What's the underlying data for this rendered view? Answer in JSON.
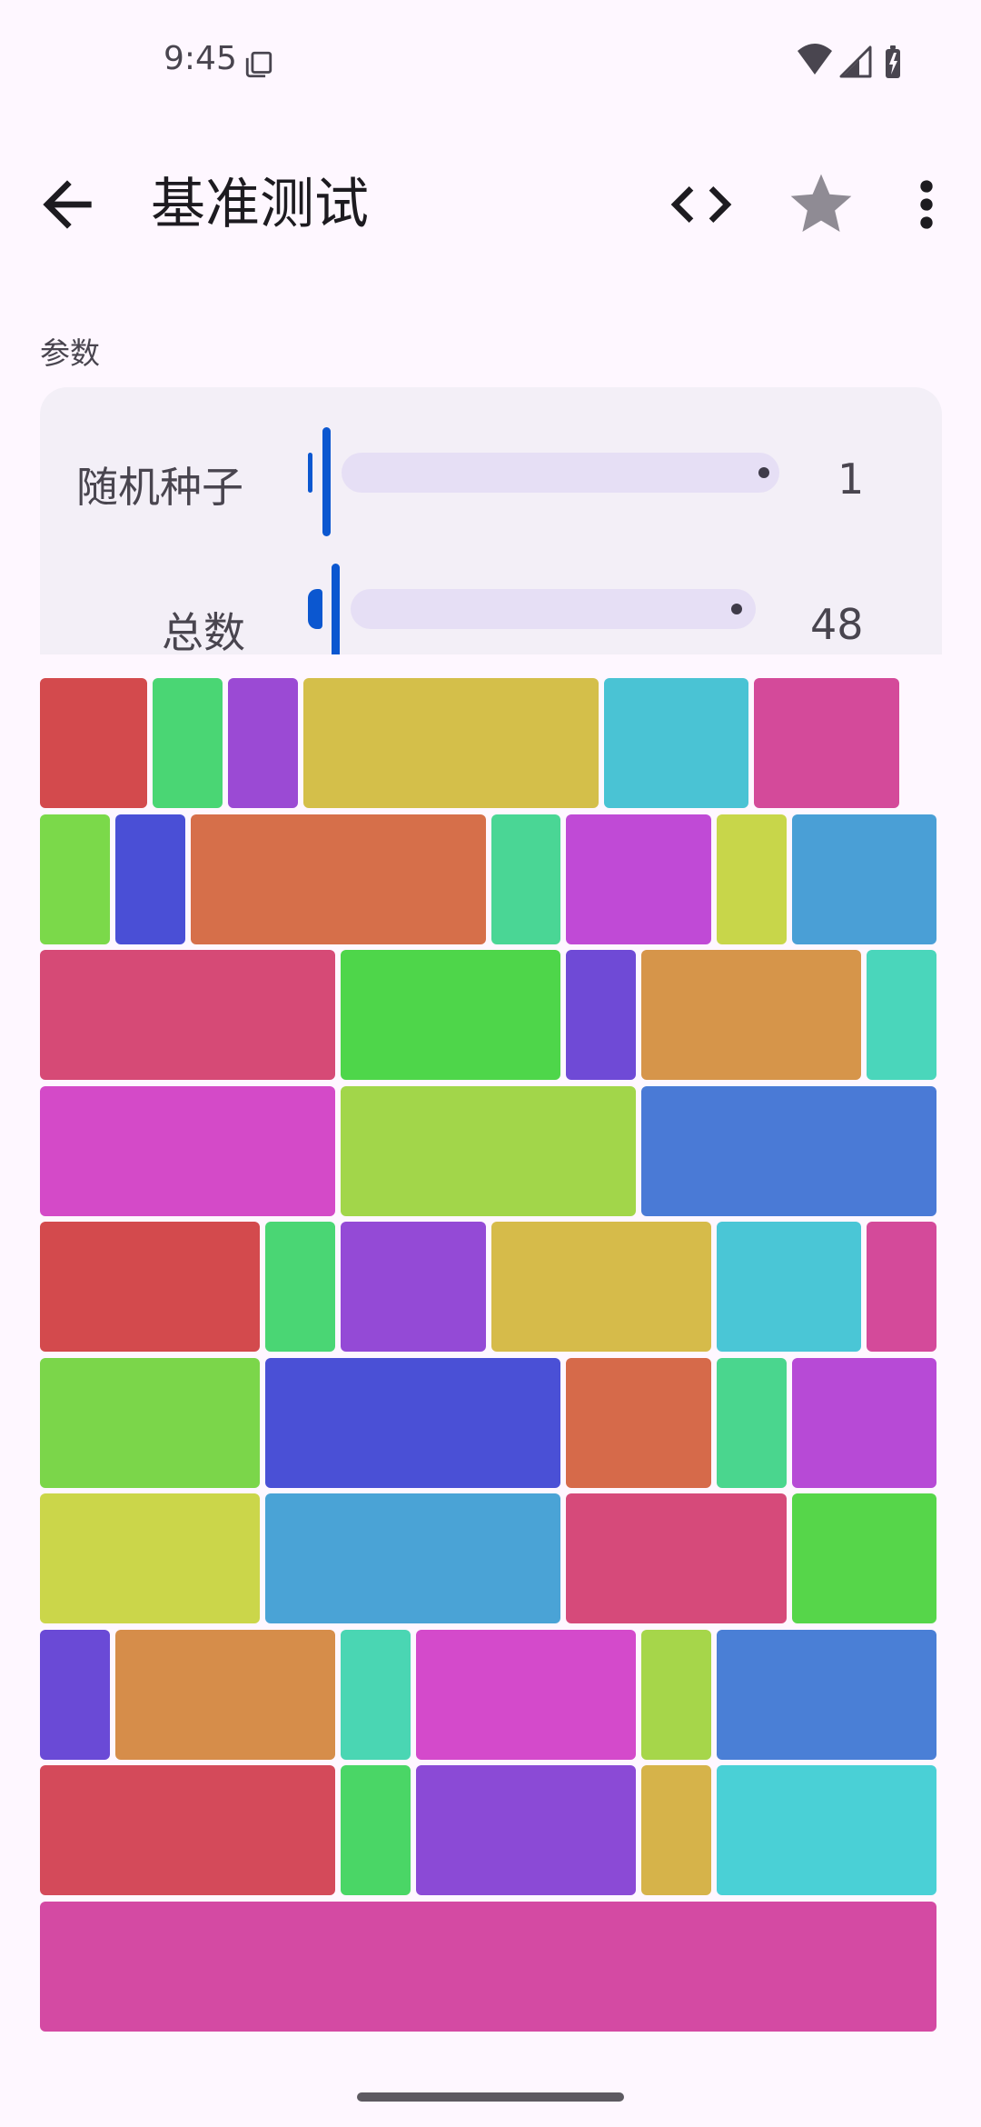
{
  "status_bar": {
    "time": "9:45",
    "icons": [
      "notification-copy-icon",
      "wifi-icon",
      "cellular-icon",
      "battery-charging-icon"
    ]
  },
  "app_bar": {
    "title": "基准测试",
    "back_icon": "arrow-back-icon",
    "actions": [
      "code-icon",
      "star-icon",
      "more-vert-icon"
    ]
  },
  "params": {
    "section_label": "参数",
    "seed": {
      "label": "随机种子",
      "value": "1"
    },
    "total": {
      "label": "总数",
      "value": "48"
    }
  },
  "tiles": {
    "colors": [
      [
        "#d34a4d",
        "#4ad674",
        "#9b4ad4",
        "#d4bf4a",
        "#4ac3d4",
        "#d44a9a"
      ],
      [
        "#7bd94a",
        "#4a4fd6",
        "#d66f4a",
        "#4ad695",
        "#c04ad6",
        "#c8d64a",
        "#4a9fd6"
      ],
      [
        "#d64a76",
        "#4ed64a",
        "#6f4ad6",
        "#d6954a",
        "#4ad6bb"
      ],
      [
        "#d44ac8",
        "#a2d64a",
        "#4a7ad6"
      ],
      [
        "#d34a4d",
        "#4ad674",
        "#944ad6",
        "#d6bb4a",
        "#4ac6d6",
        "#d44a9a"
      ],
      [
        "#7bd64a",
        "#4a50d6",
        "#d66a4a",
        "#4ad68e",
        "#b74ad6"
      ],
      [
        "#cbd64a",
        "#4aa3d6",
        "#d64a7a",
        "#56d64a"
      ],
      [
        "#6a4ad6",
        "#d68d4a",
        "#4ad6b3",
        "#d44acb",
        "#a6d64a",
        "#4a7fd6"
      ],
      [
        "#d44a5a",
        "#4ad666",
        "#8b4ad6",
        "#d6b34a",
        "#4ad0d6"
      ],
      [
        "#d44aa3"
      ]
    ]
  },
  "home_indicator": "gesture-bar"
}
